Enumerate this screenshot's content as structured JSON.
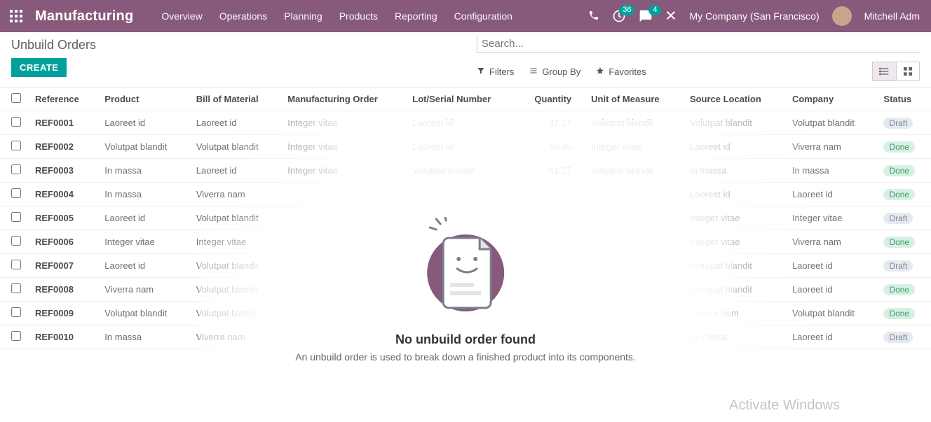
{
  "navbar": {
    "brand": "Manufacturing",
    "menu": [
      "Overview",
      "Operations",
      "Planning",
      "Products",
      "Reporting",
      "Configuration"
    ],
    "activities_count": "36",
    "discuss_count": "4",
    "company": "My Company (San Francisco)",
    "user": "Mitchell Adm"
  },
  "cp": {
    "title": "Unbuild Orders",
    "create": "CREATE",
    "search_placeholder": "Search...",
    "filters": "Filters",
    "groupby": "Group By",
    "favorites": "Favorites"
  },
  "columns": {
    "reference": "Reference",
    "product": "Product",
    "bom": "Bill of Material",
    "mo": "Manufacturing Order",
    "lot": "Lot/Serial Number",
    "qty": "Quantity",
    "uom": "Unit of Measure",
    "src": "Source Location",
    "company": "Company",
    "status": "Status"
  },
  "rows": [
    {
      "ref": "REF0001",
      "product": "Laoreet id",
      "bom": "Laoreet id",
      "mo": "Integer vitae",
      "lot": "Laoreet id",
      "qty": "37.17",
      "uom": "Volutpat blandit",
      "src": "Volutpat blandit",
      "company": "Volutpat blandit",
      "status": "Draft"
    },
    {
      "ref": "REF0002",
      "product": "Volutpat blandit",
      "bom": "Volutpat blandit",
      "mo": "Integer vitae",
      "lot": "Laoreet id",
      "qty": "40.95",
      "uom": "Integer vitae",
      "src": "Laoreet id",
      "company": "Viverra nam",
      "status": "Done"
    },
    {
      "ref": "REF0003",
      "product": "In massa",
      "bom": "Laoreet id",
      "mo": "Integer vitae",
      "lot": "Volutpat blandit",
      "qty": "61.27",
      "uom": "Volutpat blandit",
      "src": "In massa",
      "company": "In massa",
      "status": "Done"
    },
    {
      "ref": "REF0004",
      "product": "In massa",
      "bom": "Viverra nam",
      "mo": "",
      "lot": "",
      "qty": "",
      "uom": "",
      "src": "Laoreet id",
      "company": "Laoreet id",
      "status": "Done"
    },
    {
      "ref": "REF0005",
      "product": "Laoreet id",
      "bom": "Volutpat blandit",
      "mo": "",
      "lot": "",
      "qty": "",
      "uom": "",
      "src": "Integer vitae",
      "company": "Integer vitae",
      "status": "Draft"
    },
    {
      "ref": "REF0006",
      "product": "Integer vitae",
      "bom": "Integer vitae",
      "mo": "",
      "lot": "",
      "qty": "",
      "uom": "",
      "src": "Integer vitae",
      "company": "Viverra nam",
      "status": "Done"
    },
    {
      "ref": "REF0007",
      "product": "Laoreet id",
      "bom": "Volutpat blandit",
      "mo": "",
      "lot": "",
      "qty": "",
      "uom": "",
      "src": "Volutpat blandit",
      "company": "Laoreet id",
      "status": "Draft"
    },
    {
      "ref": "REF0008",
      "product": "Viverra nam",
      "bom": "Volutpat blandit",
      "mo": "",
      "lot": "",
      "qty": "",
      "uom": "",
      "src": "Volutpat blandit",
      "company": "Laoreet id",
      "status": "Done"
    },
    {
      "ref": "REF0009",
      "product": "Volutpat blandit",
      "bom": "Volutpat blandit",
      "mo": "",
      "lot": "",
      "qty": "",
      "uom": "",
      "src": "Viverra nam",
      "company": "Volutpat blandit",
      "status": "Done"
    },
    {
      "ref": "REF0010",
      "product": "In massa",
      "bom": "Viverra nam",
      "mo": "",
      "lot": "",
      "qty": "",
      "uom": "",
      "src": "In massa",
      "company": "Laoreet id",
      "status": "Draft"
    }
  ],
  "empty": {
    "title": "No unbuild order found",
    "text": "An unbuild order is used to break down a finished product into its components."
  },
  "footer": {
    "winact": "Activate Windows"
  }
}
